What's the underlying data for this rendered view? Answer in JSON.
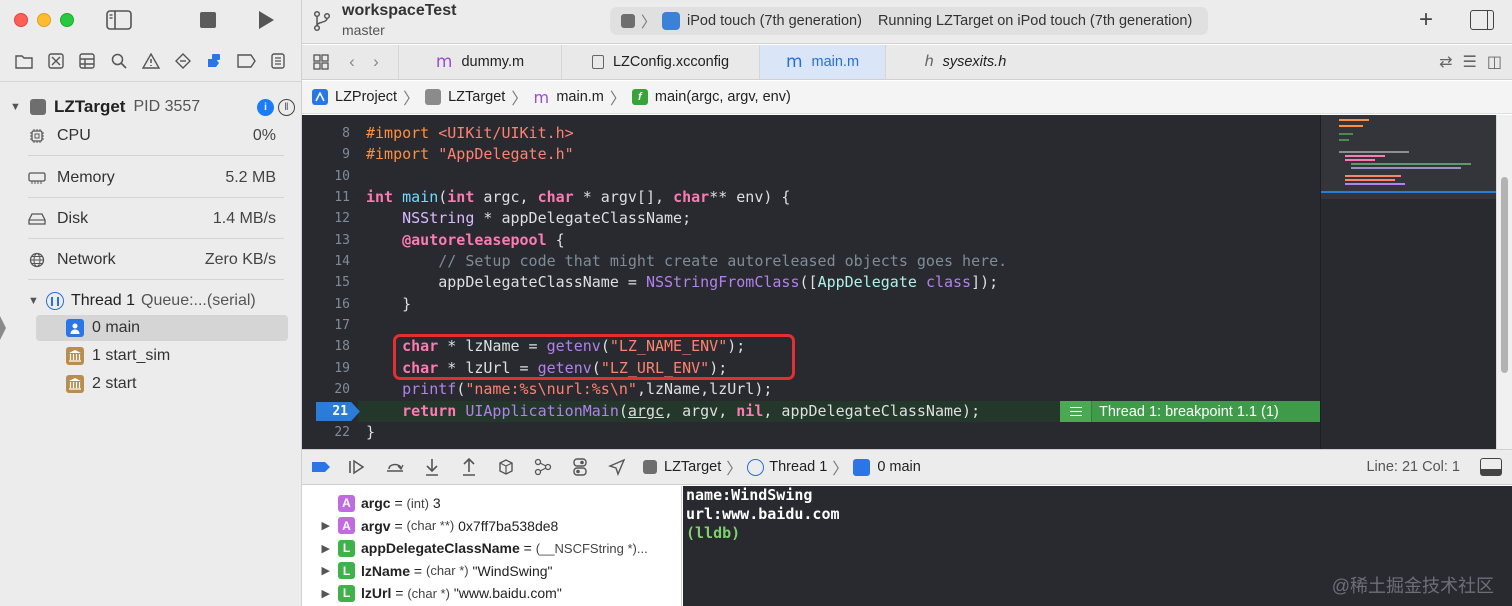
{
  "toolbar": {
    "project": "workspaceTest",
    "branch": "master",
    "activity_device": "iPod touch (7th generation)",
    "activity_status": "Running LZTarget on iPod touch (7th generation)"
  },
  "debug_nav": {
    "target_name": "LZTarget",
    "pid": "PID 3557",
    "gauges": [
      {
        "label": "CPU",
        "value": "0%",
        "icon": "cpu-icon"
      },
      {
        "label": "Memory",
        "value": "5.2 MB",
        "icon": "memory-icon"
      },
      {
        "label": "Disk",
        "value": "1.4 MB/s",
        "icon": "disk-icon"
      },
      {
        "label": "Network",
        "value": "Zero KB/s",
        "icon": "network-icon"
      }
    ],
    "thread_name": "Thread 1",
    "thread_queue": "Queue:...(serial)",
    "frames": [
      {
        "label": "0 main"
      },
      {
        "label": "1 start_sim"
      },
      {
        "label": "2 start"
      }
    ]
  },
  "tabs": [
    {
      "label": "dummy.m"
    },
    {
      "label": "LZConfig.xcconfig"
    },
    {
      "label": "main.m"
    },
    {
      "label": "sysexits.h"
    }
  ],
  "jumpbar": {
    "project": "LZProject",
    "group": "LZTarget",
    "file": "main.m",
    "symbol": "main(argc, argv, env)"
  },
  "editor": {
    "line_numbers": [
      "8",
      "9",
      "10",
      "11",
      "12",
      "13",
      "14",
      "15",
      "16",
      "17",
      "18",
      "19",
      "20",
      "21",
      "22"
    ],
    "current_line": "21",
    "breakpoint_label": "Thread 1: breakpoint 1.1 (1)"
  },
  "debug_bar": {
    "target": "LZTarget",
    "thread": "Thread 1",
    "frame": "0 main",
    "line_col": "Line: 21  Col: 1"
  },
  "variables": [
    {
      "badge": "A",
      "name": "argc",
      "eq": " = ",
      "type": "(int)",
      "value": " 3",
      "expandable": false
    },
    {
      "badge": "A",
      "name": "argv",
      "eq": " = ",
      "type": "(char **)",
      "value": " 0x7ff7ba538de8",
      "expandable": true
    },
    {
      "badge": "L",
      "name": "appDelegateClassName",
      "eq": " = ",
      "type": "(__NSCFString *)...",
      "value": "",
      "expandable": true
    },
    {
      "badge": "L",
      "name": "lzName",
      "eq": " = ",
      "type": "(char *)",
      "value": " \"WindSwing\"",
      "expandable": true
    },
    {
      "badge": "L",
      "name": "lzUrl",
      "eq": " = ",
      "type": "(char *)",
      "value": " \"www.baidu.com\"",
      "expandable": true
    }
  ],
  "console": {
    "lines": [
      "name:WindSwing",
      "url:www.baidu.com"
    ],
    "prompt": "(lldb)"
  },
  "watermark": "@稀土掘金技术社区",
  "colors": {
    "editor_bg": "#292a30",
    "keyword": "#ff7ab2",
    "string": "#ff8170",
    "breakpoint_banner": "#3f9a4a",
    "current_line_arrow": "#2b7bd8",
    "highlight_box": "#e0302f"
  }
}
